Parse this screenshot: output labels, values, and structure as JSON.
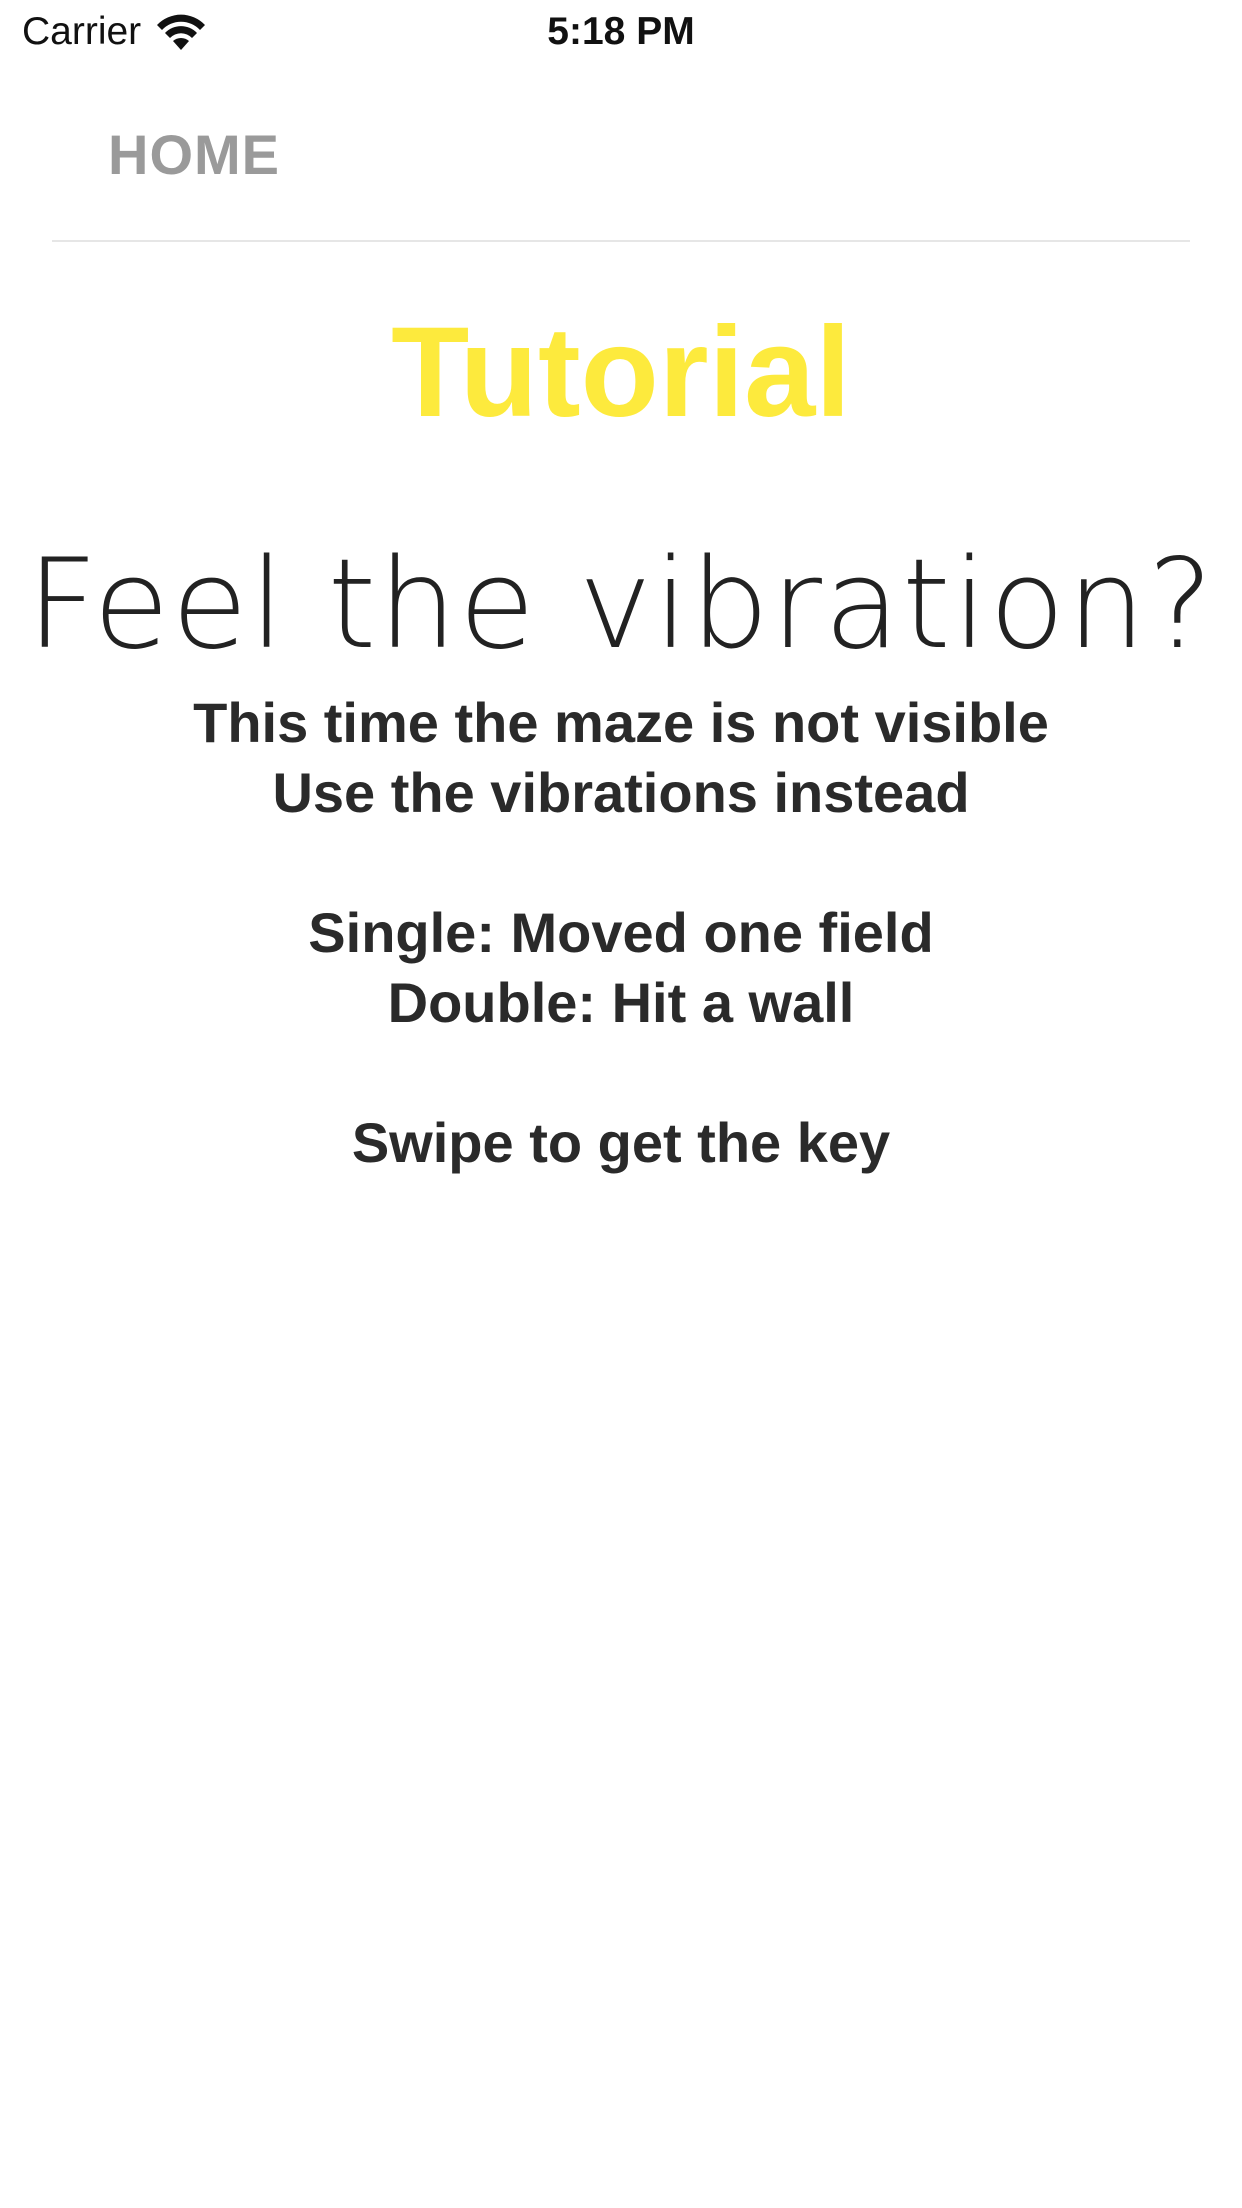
{
  "status_bar": {
    "carrier": "Carrier",
    "time": "5:18 PM",
    "wifi_icon": "wifi-icon"
  },
  "nav": {
    "home_label": "HOME"
  },
  "content": {
    "title": "Tutorial",
    "headline": "Feel the vibration?",
    "lines": [
      "This time the maze is not visible",
      "Use the vibrations instead",
      "Single: Moved one field",
      "Double: Hit a wall",
      "Swipe to get the key"
    ]
  },
  "colors": {
    "title": "#fdea3d",
    "home": "#9a9a9a",
    "text": "#2a2a2a"
  }
}
